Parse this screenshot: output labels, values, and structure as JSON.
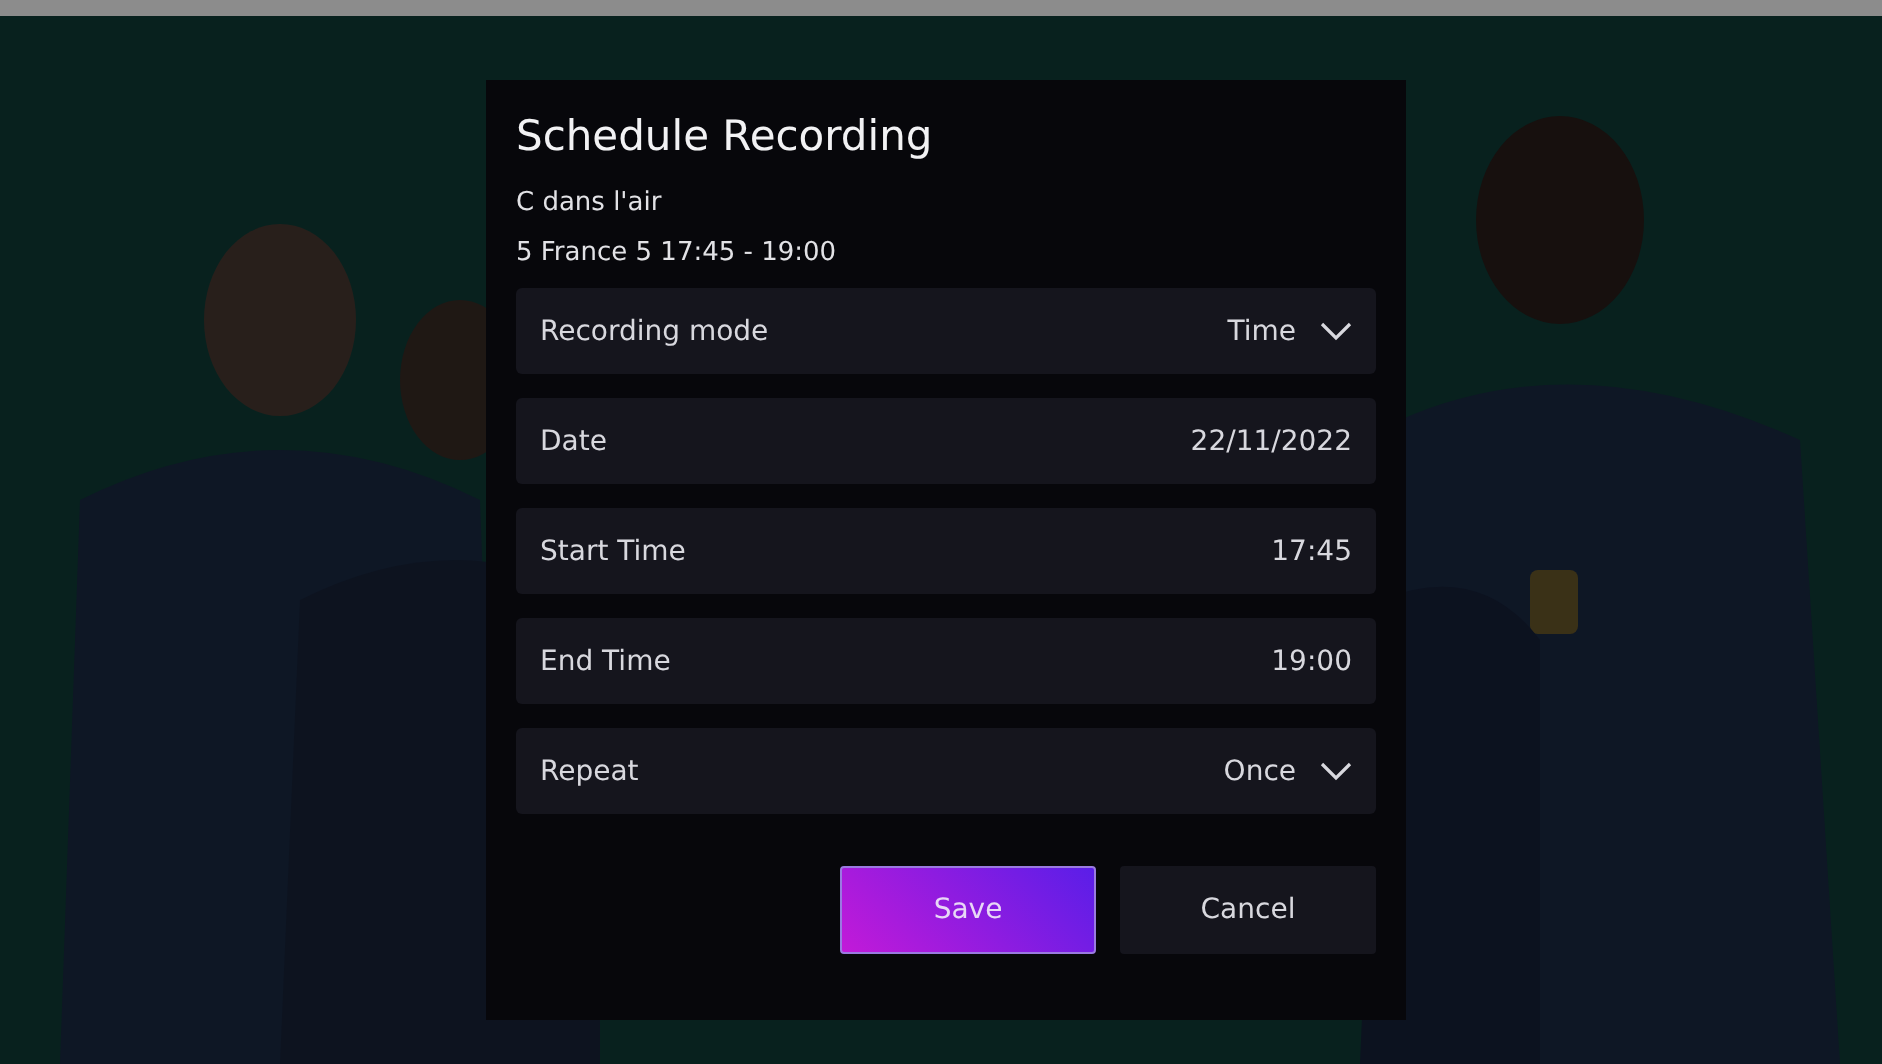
{
  "dialog": {
    "title": "Schedule Recording",
    "program": "C dans l'air",
    "details": "5 France 5 17:45 - 19:00",
    "fields": [
      {
        "kind": "dropdown",
        "label": "Recording mode",
        "value": "Time"
      },
      {
        "kind": "value",
        "label": "Date",
        "value": "22/11/2022"
      },
      {
        "kind": "value",
        "label": "Start Time",
        "value": "17:45"
      },
      {
        "kind": "value",
        "label": "End Time",
        "value": "19:00"
      },
      {
        "kind": "dropdown",
        "label": "Repeat",
        "value": "Once"
      }
    ],
    "buttons": [
      {
        "label": "Save",
        "selected": true
      },
      {
        "label": "Cancel",
        "selected": false
      }
    ]
  }
}
